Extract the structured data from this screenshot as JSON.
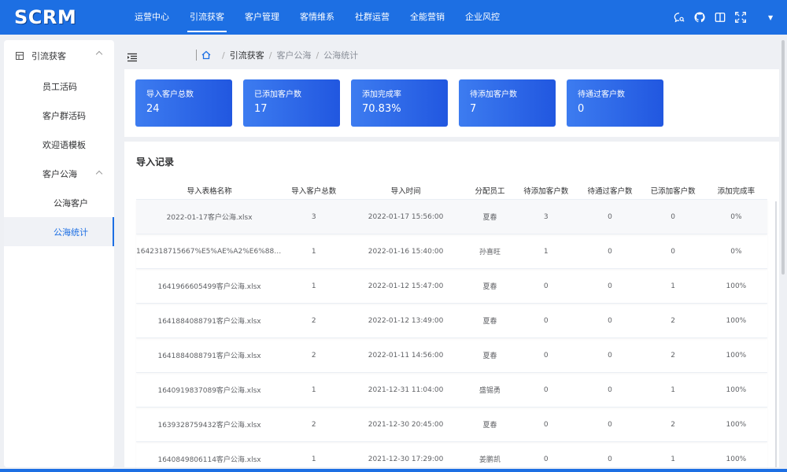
{
  "app": {
    "logo": "SCRM"
  },
  "topnav": [
    {
      "label": "运营中心",
      "active": false
    },
    {
      "label": "引流获客",
      "active": true
    },
    {
      "label": "客户管理",
      "active": false
    },
    {
      "label": "客情维系",
      "active": false
    },
    {
      "label": "社群运营",
      "active": false
    },
    {
      "label": "全能营销",
      "active": false
    },
    {
      "label": "企业风控",
      "active": false
    }
  ],
  "top_icons": [
    "chat-search-icon",
    "github-icon",
    "book-icon",
    "fullscreen-icon",
    "dropdown-caret-icon"
  ],
  "sidebar": {
    "group": "引流获客",
    "items": [
      "员工活码",
      "客户群活码",
      "欢迎语模板"
    ],
    "sub_group": "客户公海",
    "sub_items": [
      "公海客户",
      "公海统计"
    ]
  },
  "breadcrumb": {
    "c1": "引流获客",
    "c2": "客户公海",
    "c3": "公海统计",
    "sep": "/"
  },
  "stats": [
    {
      "label": "导入客户总数",
      "value": "24"
    },
    {
      "label": "已添加客户数",
      "value": "17"
    },
    {
      "label": "添加完成率",
      "value": "70.83%"
    },
    {
      "label": "待添加客户数",
      "value": "7"
    },
    {
      "label": "待通过客户数",
      "value": "0"
    }
  ],
  "section_title": "导入记录",
  "table": {
    "headers": [
      "导入表格名称",
      "导入客户总数",
      "导入时间",
      "分配员工",
      "待添加客户数",
      "待通过客户数",
      "已添加客户数",
      "添加完成率"
    ],
    "rows": [
      [
        "2022-01-17客户公海.xlsx",
        "3",
        "2022-01-17 15:56:00",
        "夏春",
        "3",
        "0",
        "0",
        "0%"
      ],
      [
        "1642318715667%E5%AE%A2%E6%88%B...",
        "1",
        "2022-01-16 15:40:00",
        "孙喜旺",
        "1",
        "0",
        "0",
        "0%"
      ],
      [
        "1641966605499客户公海.xlsx",
        "1",
        "2022-01-12 15:47:00",
        "夏春",
        "0",
        "0",
        "1",
        "100%"
      ],
      [
        "1641884088791客户公海.xlsx",
        "2",
        "2022-01-12 13:49:00",
        "夏春",
        "0",
        "0",
        "2",
        "100%"
      ],
      [
        "1641884088791客户公海.xlsx",
        "2",
        "2022-01-11 14:56:00",
        "夏春",
        "0",
        "0",
        "2",
        "100%"
      ],
      [
        "1640919837089客户公海.xlsx",
        "1",
        "2021-12-31 11:04:00",
        "盛锡勇",
        "0",
        "0",
        "1",
        "100%"
      ],
      [
        "1639328759432客户公海.xlsx",
        "2",
        "2021-12-30 20:45:00",
        "夏春",
        "0",
        "0",
        "2",
        "100%"
      ],
      [
        "1640849806114客户公海.xlsx",
        "1",
        "2021-12-30 17:29:00",
        "姜鹏凯",
        "0",
        "0",
        "1",
        "100%"
      ]
    ]
  },
  "colors": {
    "primary": "#1d6fe3",
    "card_start": "#3d7cf0",
    "card_end": "#2157e0"
  }
}
